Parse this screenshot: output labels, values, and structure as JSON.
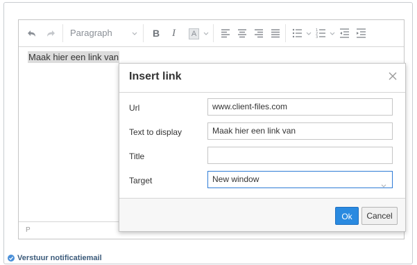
{
  "toolbar": {
    "undo_icon": "undo-icon",
    "redo_icon": "redo-icon",
    "format_select": "Paragraph",
    "bold_label": "B",
    "italic_label": "I",
    "color_label": "A"
  },
  "editor": {
    "content_text": "Maak hier een link van",
    "status_path": "P"
  },
  "dialog": {
    "title": "Insert link",
    "close_icon": "close-icon",
    "fields": [
      {
        "label": "Url",
        "value": "www.client-files.com",
        "placeholder": ""
      },
      {
        "label": "Text to display",
        "value": "Maak hier een link van",
        "placeholder": ""
      },
      {
        "label": "Title",
        "value": "",
        "placeholder": ""
      },
      {
        "label": "Target",
        "value": "New window",
        "placeholder": ""
      }
    ],
    "ok_label": "Ok",
    "cancel_label": "Cancel"
  },
  "notification": {
    "label": "Verstuur notificatiemail",
    "checked": true
  },
  "colors": {
    "accent": "#2a8ae0",
    "selection_bg": "#dcdcdc"
  }
}
